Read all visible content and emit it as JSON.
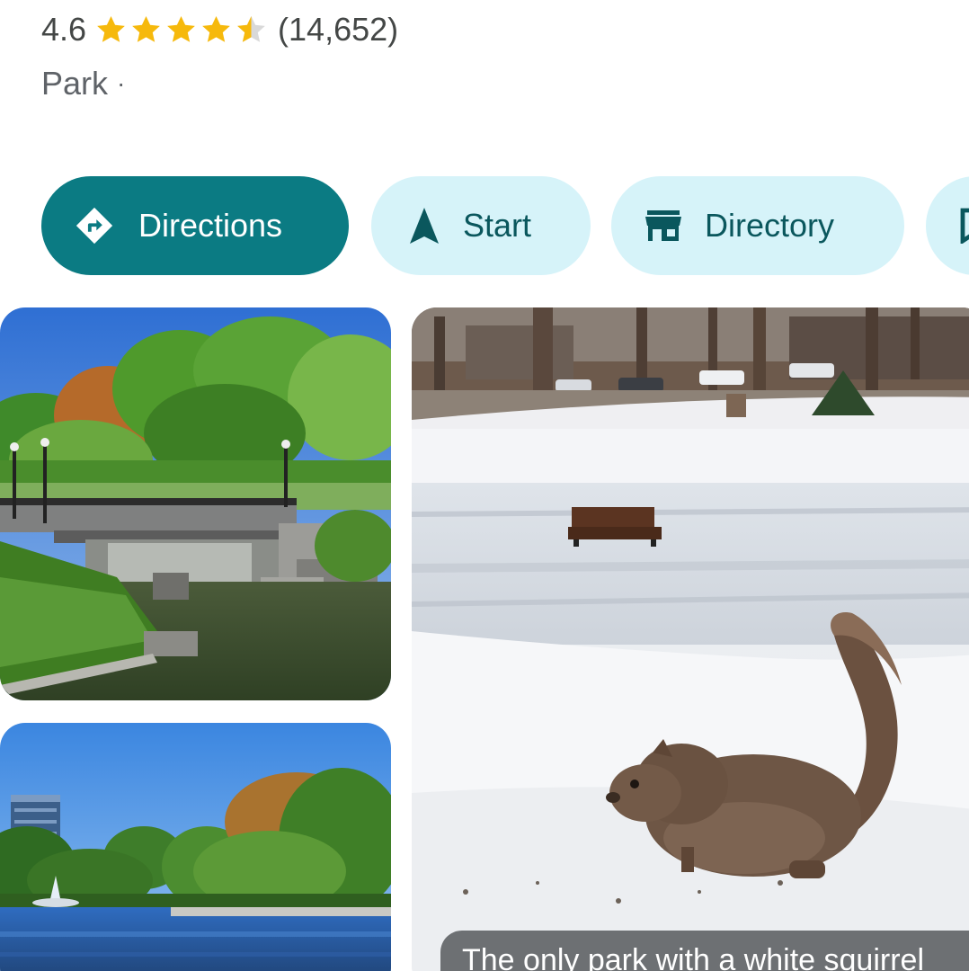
{
  "place": {
    "rating": "4.6",
    "stars_filled": 4.5,
    "stars_total": 5,
    "review_count": "(14,652)",
    "category": "Park",
    "category_separator": "·"
  },
  "actions": [
    {
      "label": "Directions",
      "icon": "directions-icon",
      "style": "primary"
    },
    {
      "label": "Start",
      "icon": "navigation-arrow-icon",
      "style": "secondary"
    },
    {
      "label": "Directory",
      "icon": "storefront-icon",
      "style": "secondary"
    },
    {
      "label": "",
      "icon": "bookmark-icon",
      "style": "secondary"
    }
  ],
  "photos": [
    {
      "subject": "park-waterfall-bridge"
    },
    {
      "subject": "squirrel-in-snow",
      "caption": "The only park with a white squirrel"
    },
    {
      "subject": "pond-fountain"
    }
  ],
  "colors": {
    "primary_chip": "#0b7b83",
    "secondary_chip": "#d6f3f9",
    "secondary_text": "#0a575d",
    "star": "#f6b90c",
    "text_muted": "#444746"
  }
}
